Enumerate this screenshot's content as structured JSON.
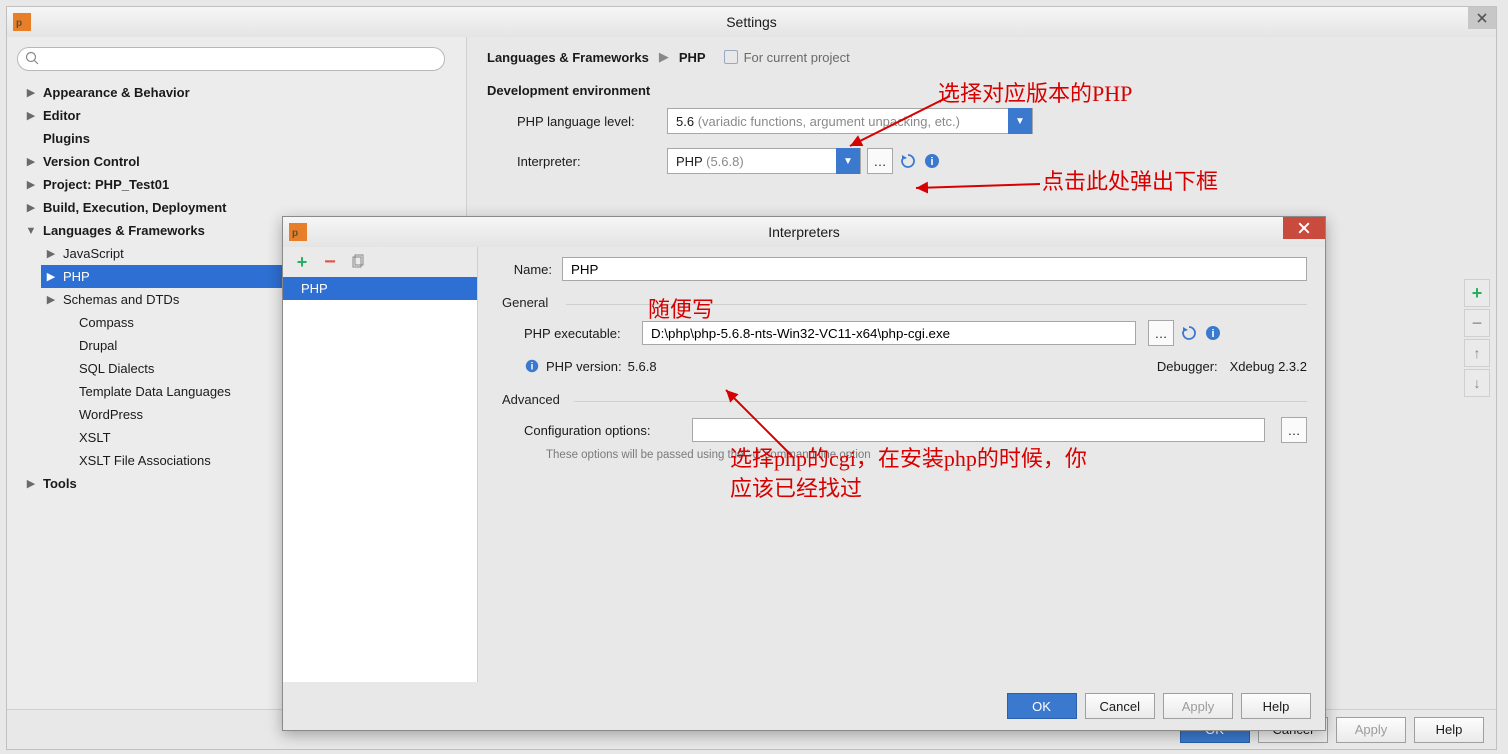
{
  "settings": {
    "title": "Settings",
    "sidebar": {
      "search_placeholder": "",
      "nodes": {
        "appearance": "Appearance & Behavior",
        "editor": "Editor",
        "plugins": "Plugins",
        "vcs": "Version Control",
        "project": "Project: PHP_Test01",
        "build": "Build, Execution, Deployment",
        "lang": "Languages & Frameworks",
        "tools": "Tools",
        "lang_children": {
          "javascript": "JavaScript",
          "php": "PHP",
          "schemas": "Schemas and DTDs",
          "compass": "Compass",
          "drupal": "Drupal",
          "sqldialects": "SQL Dialects",
          "templatedata": "Template Data Languages",
          "wordpress": "WordPress",
          "xslt": "XSLT",
          "xsltfile": "XSLT File Associations"
        }
      }
    },
    "main": {
      "crumb_root": "Languages & Frameworks",
      "crumb_leaf": "PHP",
      "scope": "For current project",
      "dev_env": "Development environment",
      "lang_level_label": "PHP language level:",
      "lang_level_value": "5.6 ",
      "lang_level_hint": "(variadic functions, argument unpacking, etc.)",
      "interpreter_label": "Interpreter:",
      "interpreter_value": "PHP ",
      "interpreter_hint": "(5.6.8)"
    },
    "footer": {
      "ok": "OK",
      "cancel": "Cancel",
      "apply": "Apply",
      "help": "Help"
    }
  },
  "interpreters": {
    "title": "Interpreters",
    "list_item": "PHP",
    "name_label": "Name:",
    "name_value": "PHP",
    "general_label": "General",
    "exec_label": "PHP executable:",
    "exec_value": "D:\\php\\php-5.6.8-nts-Win32-VC11-x64\\php-cgi.exe",
    "ver_label": "PHP version:",
    "ver_value": "5.6.8",
    "dbg_label": "Debugger:",
    "dbg_value": "Xdebug 2.3.2",
    "advanced_label": "Advanced",
    "cfg_label": "Configuration options:",
    "cfg_hint": "These options will be passed using the '-d' command line option",
    "footer": {
      "ok": "OK",
      "cancel": "Cancel",
      "apply": "Apply",
      "help": "Help"
    }
  },
  "annotations": {
    "a1": "选择对应版本的PHP",
    "a2": "点击此处弹出下框",
    "a3": "随便写",
    "a4_line1": "选择php的cgi，在安装php的时候，你",
    "a4_line2": "应该已经找过"
  }
}
